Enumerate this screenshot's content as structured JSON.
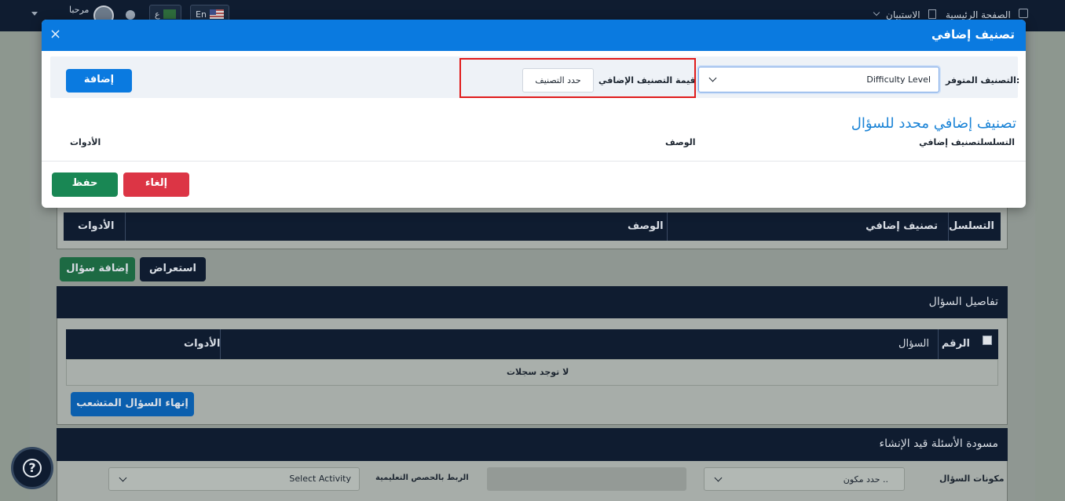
{
  "topnav": {
    "home": "الصفحة الرئيسية",
    "survey": "الاستبيان",
    "greeting": "مرحبا",
    "lang_en": "En",
    "lang_ar": "ع"
  },
  "background": {
    "table1": {
      "col_serial": "التسلسل",
      "col_extra": "تصنيف إضافي",
      "col_desc": "الوصف",
      "col_tools": "الأدوات"
    },
    "btn_view": "استعراض",
    "btn_add_question": "إضافة سؤال",
    "details_title": "تفاصيل السؤال",
    "table2": {
      "col_num": "الرقم",
      "col_question": "السؤال",
      "col_tools": "الأدوات",
      "empty": "لا توجد سجلات"
    },
    "btn_end_branch": "إنهاء السؤال المتشعب",
    "drafts_title": "مسودة الأسئلة قيد الإنشاء",
    "components_label": "مكونات السؤال",
    "components_placeholder": "حدد مكون ..",
    "link_label": "الربط بالحصص التعليمية",
    "activity_value": "Select Activity"
  },
  "modal": {
    "title": "تصنيف إضافي",
    "close": "×",
    "available_label": "التصنيف المتوفر:",
    "available_value": "Difficulty Level",
    "value_label": "قيمة التصنيف الإضافي",
    "value_input": "حدد التصنيف",
    "add_button": "إضافة",
    "section_title": "تصنيف إضافي محدد للسؤال",
    "col_serial_extra": "التسلسلتصنيف إضافي",
    "col_desc": "الوصف",
    "col_tools": "الأدوات",
    "cancel_button": "إلغاء",
    "save_button": "حفظ"
  },
  "colors": {
    "primary": "#0a7ae0",
    "success": "#198754",
    "danger": "#dc3545",
    "navy": "#0f1c30",
    "highlight": "#e01b1b"
  },
  "icons": [
    "home-icon",
    "survey-icon",
    "close-icon",
    "chevron-down-icon",
    "bell-icon",
    "help-icon",
    "checkbox-icon"
  ]
}
